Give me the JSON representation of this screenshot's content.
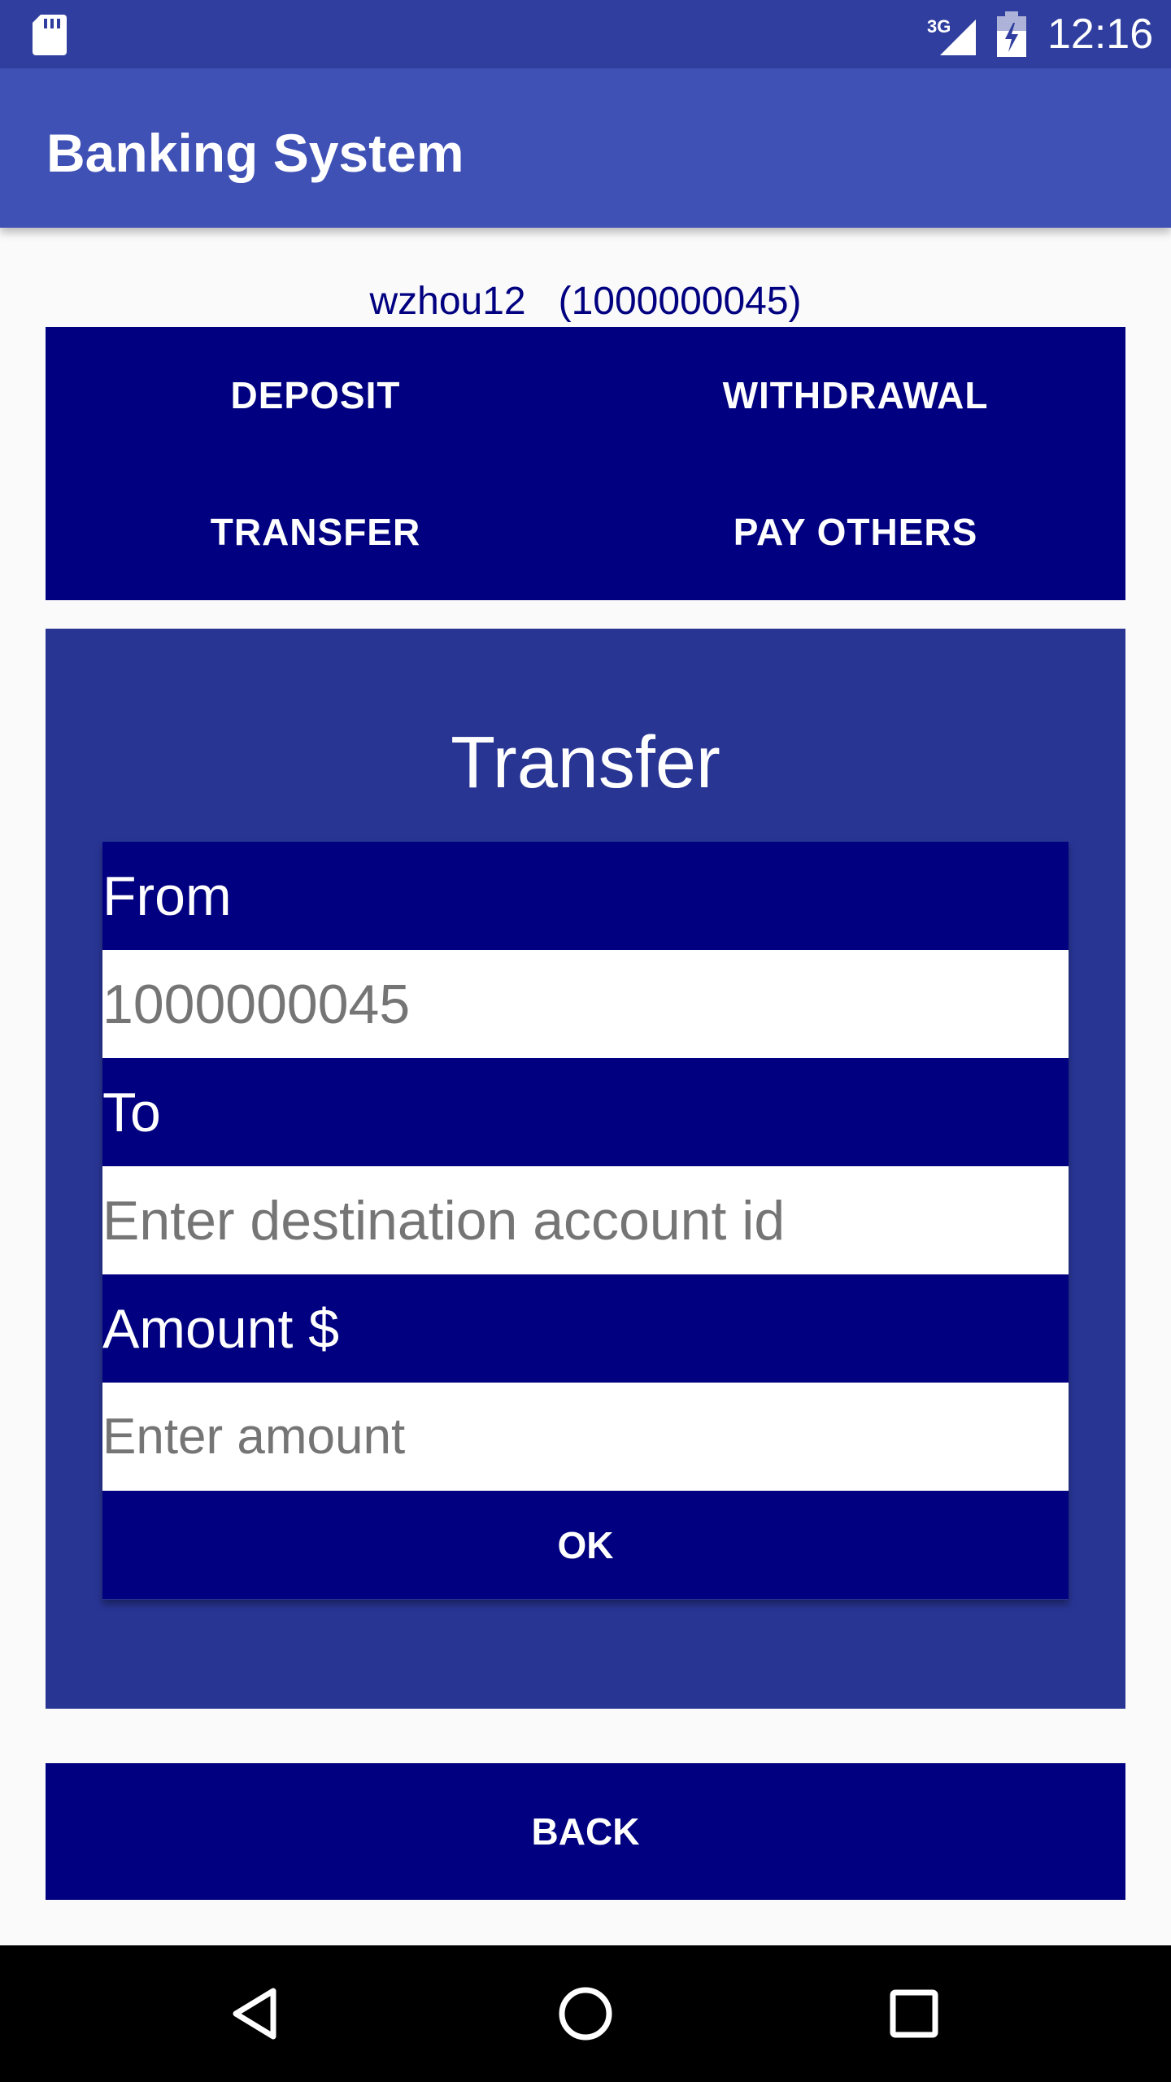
{
  "status_bar": {
    "time": "12:16",
    "network": "3G",
    "icons": [
      "sd-card-icon",
      "signal-icon",
      "battery-charging-icon"
    ]
  },
  "app_bar": {
    "title": "Banking System"
  },
  "account": {
    "line": "wzhou12   (1000000045)"
  },
  "menu": {
    "deposit": "DEPOSIT",
    "withdrawal": "WITHDRAWAL",
    "transfer": "TRANSFER",
    "pay_others": "PAY OTHERS"
  },
  "transfer_form": {
    "title": "Transfer",
    "from_label": "From",
    "from_value": "1000000045",
    "to_label": "To",
    "to_placeholder": "Enter destination account id",
    "amount_label": "Amount $",
    "amount_placeholder": "Enter amount",
    "ok_label": "OK"
  },
  "back_label": "BACK",
  "nav_bar": {
    "icons": [
      "back-triangle-icon",
      "home-circle-icon",
      "recents-square-icon"
    ]
  },
  "colors": {
    "status_bar": "#303f9f",
    "app_bar": "#3f51b5",
    "navy": "#000080",
    "panel": "#283593",
    "background": "#fafafa"
  }
}
